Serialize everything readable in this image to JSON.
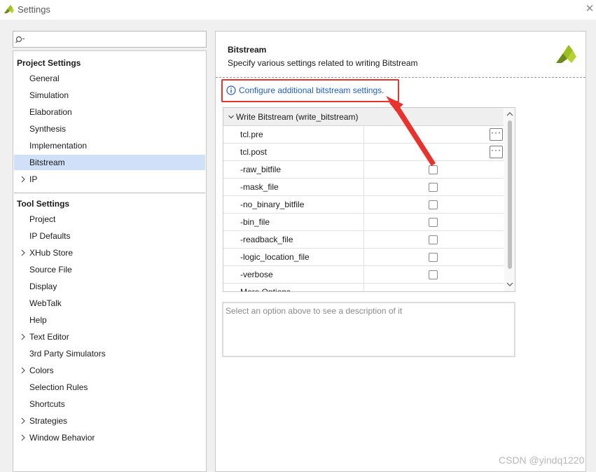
{
  "window": {
    "title": "Settings",
    "close_icon": "close-icon"
  },
  "search": {
    "value": "",
    "placeholder": ""
  },
  "tree": {
    "project_header": "Project Settings",
    "project_items": [
      {
        "label": "General",
        "expandable": false
      },
      {
        "label": "Simulation",
        "expandable": false
      },
      {
        "label": "Elaboration",
        "expandable": false
      },
      {
        "label": "Synthesis",
        "expandable": false
      },
      {
        "label": "Implementation",
        "expandable": false
      },
      {
        "label": "Bitstream",
        "expandable": false,
        "selected": true
      },
      {
        "label": "IP",
        "expandable": true
      }
    ],
    "tool_header": "Tool Settings",
    "tool_items": [
      {
        "label": "Project",
        "expandable": false
      },
      {
        "label": "IP Defaults",
        "expandable": false
      },
      {
        "label": "XHub Store",
        "expandable": true
      },
      {
        "label": "Source File",
        "expandable": false
      },
      {
        "label": "Display",
        "expandable": false
      },
      {
        "label": "WebTalk",
        "expandable": false
      },
      {
        "label": "Help",
        "expandable": false
      },
      {
        "label": "Text Editor",
        "expandable": true
      },
      {
        "label": "3rd Party Simulators",
        "expandable": false
      },
      {
        "label": "Colors",
        "expandable": true
      },
      {
        "label": "Selection Rules",
        "expandable": false
      },
      {
        "label": "Shortcuts",
        "expandable": false
      },
      {
        "label": "Strategies",
        "expandable": true
      },
      {
        "label": "Window Behavior",
        "expandable": true
      }
    ]
  },
  "main": {
    "title": "Bitstream",
    "subtitle": "Specify various settings related to writing Bitstream",
    "info_link": "Configure additional bitstream settings.",
    "group_label": "Write Bitstream (write_bitstream)",
    "properties": [
      {
        "name": "tcl.pre",
        "control": "browse",
        "checked": false
      },
      {
        "name": "tcl.post",
        "control": "browse",
        "checked": false
      },
      {
        "name": "-raw_bitfile",
        "control": "checkbox",
        "checked": false
      },
      {
        "name": "-mask_file",
        "control": "checkbox",
        "checked": false
      },
      {
        "name": "-no_binary_bitfile",
        "control": "checkbox",
        "checked": false
      },
      {
        "name": "-bin_file",
        "control": "checkbox",
        "checked": false
      },
      {
        "name": "-readback_file",
        "control": "checkbox",
        "checked": false
      },
      {
        "name": "-logic_location_file",
        "control": "checkbox",
        "checked": false
      },
      {
        "name": "-verbose",
        "control": "checkbox",
        "checked": false
      },
      {
        "name": "More Options",
        "control": "text",
        "checked": false
      }
    ],
    "browse_label": "···",
    "description": "Select an option above to see a description of it"
  },
  "watermark": "CSDN @yindq1220",
  "colors": {
    "accent_link": "#1d5ec7",
    "selected_row": "#cfe0f8",
    "annotation_red": "#e8322e",
    "logo_green": "#9bbf1e"
  }
}
